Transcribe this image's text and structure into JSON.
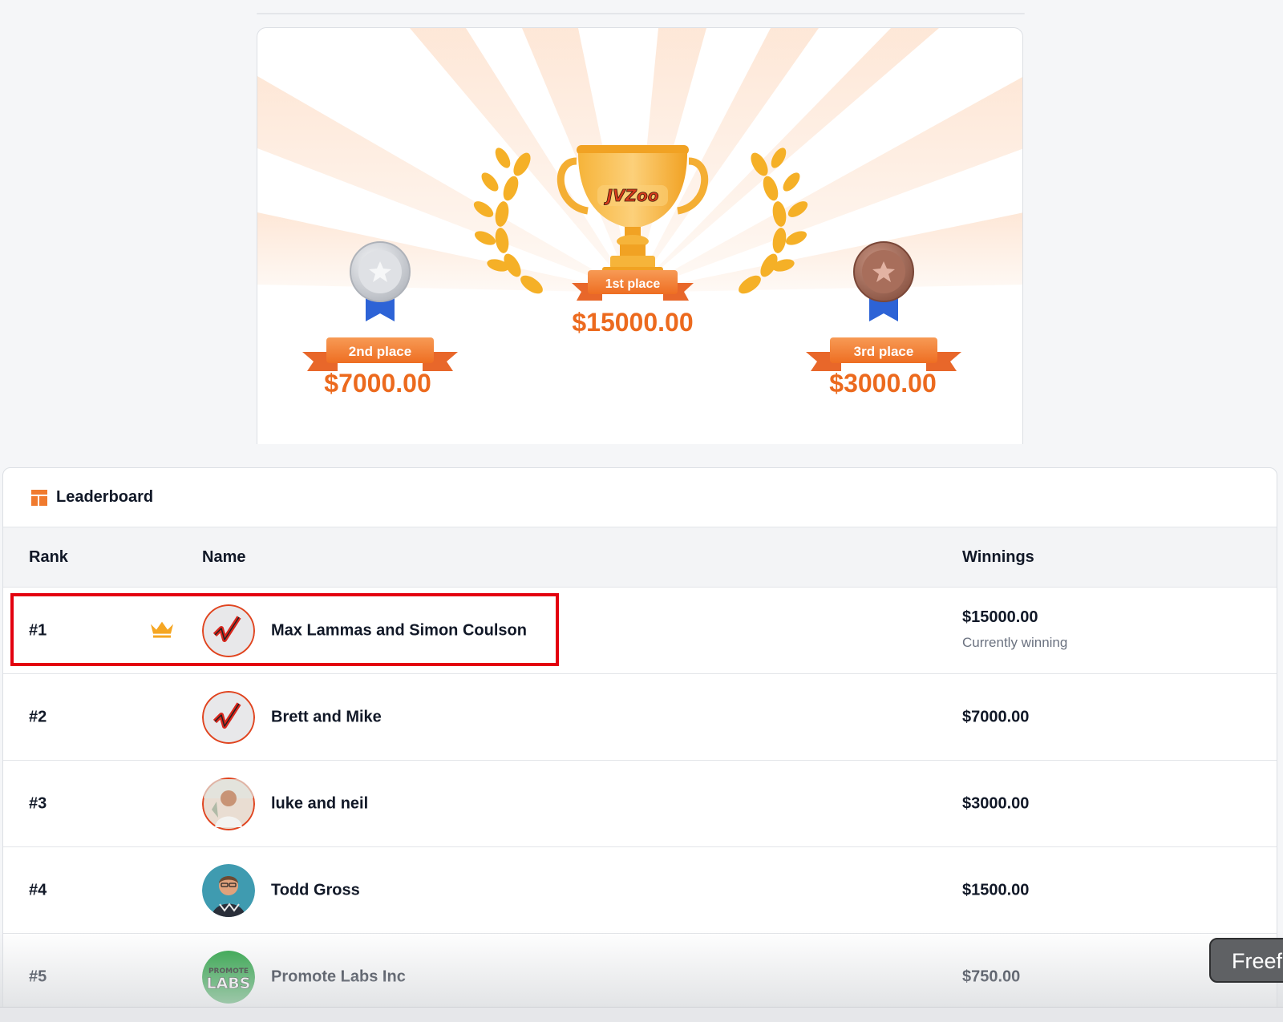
{
  "prizes": {
    "first": {
      "place": "1st place",
      "amount": "$15000.00"
    },
    "second": {
      "place": "2nd place",
      "amount": "$7000.00"
    },
    "third": {
      "place": "3rd place",
      "amount": "$3000.00"
    },
    "trophy_brand": "JVZoo"
  },
  "leaderboard": {
    "title": "Leaderboard",
    "columns": {
      "rank": "Rank",
      "name": "Name",
      "winnings": "Winnings"
    },
    "rows": [
      {
        "rank": "#1",
        "name": "Max Lammas and Simon Coulson",
        "winnings": "$15000.00",
        "status": "Currently winning",
        "avatar": "jvzoo-logo"
      },
      {
        "rank": "#2",
        "name": "Brett and Mike",
        "winnings": "$7000.00",
        "avatar": "jvzoo-logo"
      },
      {
        "rank": "#3",
        "name": "luke and neil",
        "winnings": "$3000.00",
        "avatar": "photo"
      },
      {
        "rank": "#4",
        "name": "Todd Gross",
        "winnings": "$1500.00",
        "avatar": "photo"
      },
      {
        "rank": "#5",
        "name": "Promote Labs Inc",
        "winnings": "$750.00",
        "avatar": "promote-labs-logo"
      }
    ]
  },
  "promote_logo": {
    "top": "PROMOTE",
    "bottom": "LABS"
  },
  "side_tab": {
    "label": "Freef"
  },
  "colors": {
    "accent": "#f07a2e",
    "highlight": "#e3000f",
    "gold": "#f5b027"
  }
}
